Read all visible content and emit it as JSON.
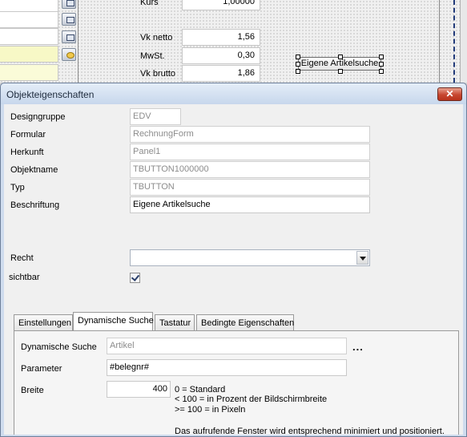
{
  "designer": {
    "labels": {
      "kurs": "Kurs",
      "vk_netto": "Vk netto",
      "mwst": "MwSt.",
      "vk_brutto": "Vk brutto"
    },
    "values": {
      "kurs": "1,00000",
      "vk_netto": "1,56",
      "mwst": "0,30",
      "vk_brutto": "1,86"
    },
    "selected_button_label": "Eigene Artikelsuche"
  },
  "dialog": {
    "title": "Objekteigenschaften",
    "close_glyph": "✕",
    "fields": {
      "designgruppe": {
        "label": "Designgruppe",
        "value": "EDV"
      },
      "formular": {
        "label": "Formular",
        "value": "RechnungForm"
      },
      "herkunft": {
        "label": "Herkunft",
        "value": "Panel1"
      },
      "objektname": {
        "label": "Objektname",
        "value": "TBUTTON1000000"
      },
      "typ": {
        "label": "Typ",
        "value": "TBUTTON"
      },
      "beschriftung": {
        "label": "Beschriftung",
        "value": "Eigene Artikelsuche"
      }
    },
    "recht": {
      "label": "Recht",
      "value": ""
    },
    "sichtbar": {
      "label": "sichtbar",
      "checked": true
    },
    "tabs": [
      {
        "label": "Einstellungen",
        "active": false
      },
      {
        "label": "Dynamische Suche",
        "active": true
      },
      {
        "label": "Tastatur",
        "active": false
      },
      {
        "label": "Bedingte Eigenschaften",
        "active": false
      }
    ],
    "dynamic_search": {
      "label": "Dynamische Suche",
      "value": "Artikel",
      "ellipsis": "...",
      "parameter_label": "Parameter",
      "parameter_value": "#belegnr#",
      "breite_label": "Breite",
      "breite_value": "400",
      "notes": [
        "0 = Standard",
        "< 100 = in Prozent der Bildschirmbreite",
        ">= 100 = in Pixeln"
      ],
      "footer_note": "Das aufrufende Fenster wird entsprechend minimiert und positioniert."
    }
  }
}
